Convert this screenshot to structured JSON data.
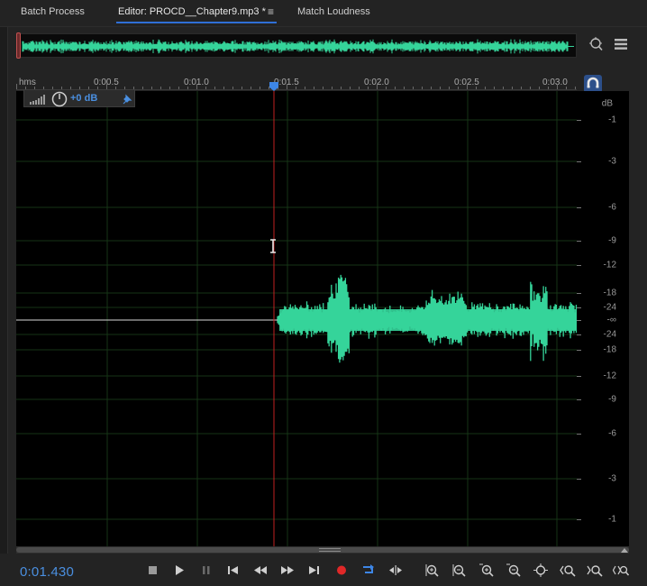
{
  "tabs": [
    {
      "label": "Batch Process"
    },
    {
      "label": "Editor: PROCD__Chapter9.mp3 *",
      "active": true
    },
    {
      "label": "Match Loudness"
    }
  ],
  "tab_menu_icon": "≡",
  "ruler": {
    "unit_label": "hms",
    "labels": [
      "0:00.5",
      "0:01.0",
      "0:01.5",
      "0:02.0",
      "0:02.5",
      "0:03.0"
    ]
  },
  "hud": {
    "gain": "+0 dB"
  },
  "db_scale": {
    "unit": "dB",
    "labels": [
      "-1",
      "-3",
      "-6",
      "-9",
      "-12",
      "-18",
      "-24",
      "-∞",
      "-24",
      "-18",
      "-12",
      "-9",
      "-6",
      "-3",
      "-1"
    ]
  },
  "playhead": {
    "time": "0:01.430"
  },
  "waveform": {
    "color": "#35d49a",
    "playhead_color": "#c02020"
  },
  "transport": {
    "timecode": "0:01.430",
    "buttons": [
      "stop-icon",
      "play-icon",
      "pause-icon",
      "go-to-start-icon",
      "rewind-icon",
      "fast-forward-icon",
      "go-to-end-icon",
      "record-icon",
      "loop-icon",
      "skip-selection-icon",
      "zoom-in-amplitude-icon",
      "zoom-out-amplitude-icon",
      "zoom-in-time-icon",
      "zoom-out-time-icon",
      "zoom-full-icon",
      "zoom-in-start-icon",
      "zoom-in-end-icon",
      "zoom-selection-icon"
    ]
  },
  "colors": {
    "accent": "#4a8fe0",
    "record": "#e02828",
    "wave": "#35d49a"
  }
}
